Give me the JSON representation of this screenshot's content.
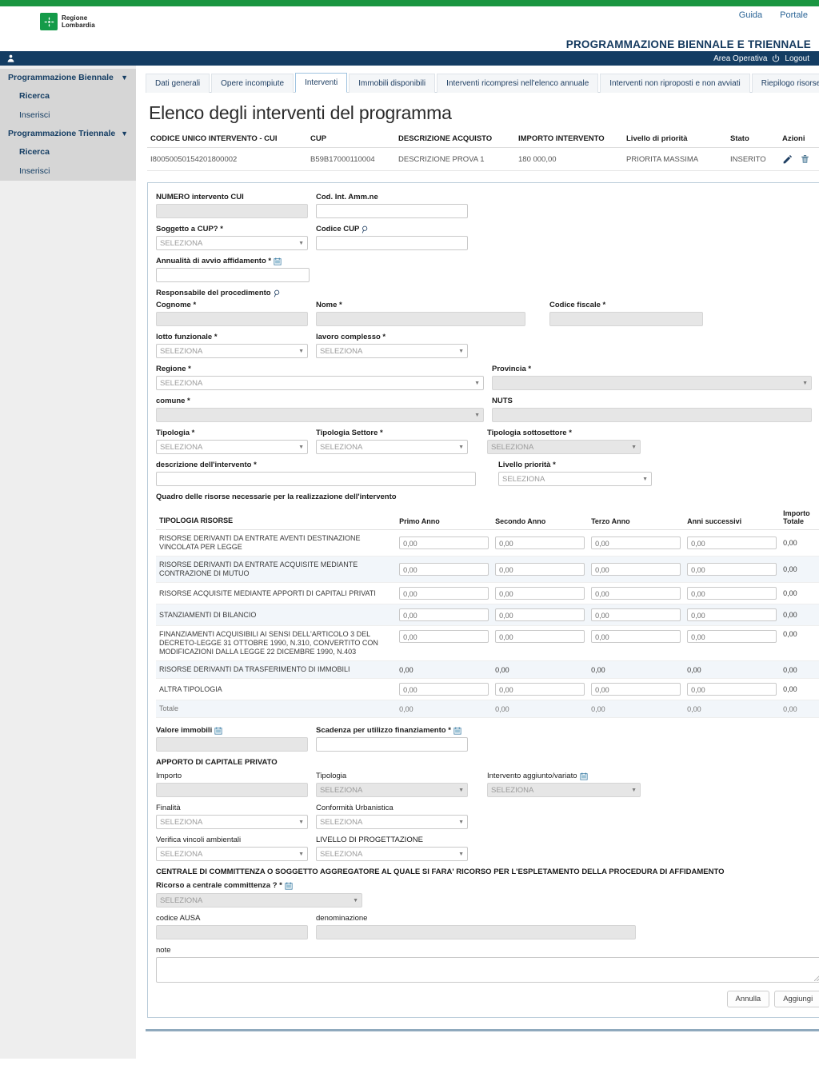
{
  "top": {
    "links": [
      {
        "label": "Guida",
        "name": "guida-link"
      },
      {
        "label": "Portale",
        "name": "portale-link"
      }
    ],
    "logo_line1": "Regione",
    "logo_line2": "Lombardia",
    "app_title": "PROGRAMMAZIONE BIENNALE E TRIENNALE",
    "user_area": "Area Operativa",
    "logout": "Logout"
  },
  "sidebar": {
    "groups": [
      {
        "label": "Programmazione Biennale",
        "caret": "▼",
        "items": [
          {
            "label": "Ricerca"
          },
          {
            "label": "Inserisci"
          }
        ]
      },
      {
        "label": "Programmazione Triennale",
        "caret": "▼",
        "items": [
          {
            "label": "Ricerca"
          },
          {
            "label": "Inserisci"
          }
        ]
      }
    ]
  },
  "tabs": [
    {
      "label": "Dati generali",
      "active": false
    },
    {
      "label": "Opere incompiute",
      "active": false
    },
    {
      "label": "Interventi",
      "active": true
    },
    {
      "label": "Immobili disponibili",
      "active": false
    },
    {
      "label": "Interventi ricompresi nell'elenco annuale",
      "active": false
    },
    {
      "label": "Interventi non riproposti e non avviati",
      "active": false
    },
    {
      "label": "Riepilogo risorse",
      "active": false
    }
  ],
  "page_title": "Elenco degli interventi del programma",
  "list_table": {
    "headers": [
      "CODICE UNICO INTERVENTO - CUI",
      "CUP",
      "DESCRIZIONE ACQUISTO",
      "IMPORTO INTERVENTO",
      "Livello di priorità",
      "Stato",
      "Azioni"
    ],
    "rows": [
      {
        "cui": "I80050050154201800002",
        "cup": "B59B17000110004",
        "descrizione": "DESCRIZIONE PROVA 1",
        "importo": "180 000,00",
        "priorita": "PRIORITA MASSIMA",
        "stato": "INSERITO"
      }
    ]
  },
  "form": {
    "numero_cui": {
      "label": "NUMERO intervento CUI",
      "value": ""
    },
    "cod_int_amm": {
      "label": "Cod. Int. Amm.ne",
      "value": ""
    },
    "soggetto_cup": {
      "label": "Soggetto a CUP? *",
      "value": "SELEZIONA"
    },
    "codice_cup": {
      "label": "Codice CUP",
      "value": ""
    },
    "annualita": {
      "label": "Annualità di avvio affidamento *",
      "value": ""
    },
    "responsabile_heading": "Responsabile del procedimento",
    "cognome": {
      "label": "Cognome *",
      "value": ""
    },
    "nome": {
      "label": "Nome *",
      "value": ""
    },
    "codice_fiscale": {
      "label": "Codice fiscale *",
      "value": ""
    },
    "lotto": {
      "label": "lotto funzionale *",
      "value": "SELEZIONA"
    },
    "lavoro": {
      "label": "lavoro complesso *",
      "value": "SELEZIONA"
    },
    "regione": {
      "label": "Regione *",
      "value": "SELEZIONA"
    },
    "provincia": {
      "label": "Provincia *",
      "value": ""
    },
    "comune": {
      "label": "comune *",
      "value": ""
    },
    "nuts": {
      "label": "NUTS",
      "value": ""
    },
    "tipologia": {
      "label": "Tipologia *",
      "value": "SELEZIONA"
    },
    "tipologia_settore": {
      "label": "Tipologia Settore *",
      "value": "SELEZIONA"
    },
    "tipologia_sottosettore": {
      "label": "Tipologia sottosettore *",
      "value": "SELEZIONA"
    },
    "descrizione_intervento": {
      "label": "descrizione dell'intervento *",
      "value": ""
    },
    "livello_priorita": {
      "label": "Livello priorità *",
      "value": "SELEZIONA"
    },
    "quadro_heading": "Quadro delle risorse necessarie per la realizzazione dell'intervento",
    "valore_immobili": {
      "label": "Valore immobili",
      "value": ""
    },
    "scadenza": {
      "label": "Scadenza per utilizzo finanziamento *",
      "value": ""
    },
    "apporto_heading": "APPORTO DI CAPITALE PRIVATO",
    "importo": {
      "label": "Importo",
      "value": ""
    },
    "tipologia_apporto": {
      "label": "Tipologia",
      "value": "SELEZIONA"
    },
    "intervento_aggiunto": {
      "label": "Intervento aggiunto/variato",
      "value": "SELEZIONA"
    },
    "finalita": {
      "label": "Finalità",
      "value": "SELEZIONA"
    },
    "conformita": {
      "label": "Conformità Urbanistica",
      "value": "SELEZIONA"
    },
    "verifica_vincoli": {
      "label": "Verifica vincoli ambientali",
      "value": "SELEZIONA"
    },
    "livello_progettazione": {
      "label": "LIVELLO DI PROGETTAZIONE",
      "value": "SELEZIONA"
    },
    "centrale_heading": "CENTRALE DI COMMITTENZA O SOGGETTO AGGREGATORE AL QUALE SI FARA' RICORSO PER L'ESPLETAMENTO DELLA PROCEDURA DI AFFIDAMENTO",
    "ricorso": {
      "label": "Ricorso a centrale committenza ? *",
      "value": "SELEZIONA"
    },
    "codice_ausa": {
      "label": "codice AUSA",
      "value": ""
    },
    "denominazione": {
      "label": "denominazione",
      "value": ""
    },
    "note": {
      "label": "note",
      "value": ""
    },
    "cancel_label": "Annulla",
    "submit_label": "Aggiungi"
  },
  "resources_table": {
    "headers": [
      "TIPOLOGIA RISORSE",
      "Primo Anno",
      "Secondo Anno",
      "Terzo Anno",
      "Anni successivi",
      "Importo Totale"
    ],
    "total_header_line1": "Importo",
    "total_header_line2": "Totale",
    "rows": [
      {
        "name": "RISORSE DERIVANTI DA ENTRATE AVENTI DESTINAZIONE VINCOLATA PER LEGGE",
        "editable": true,
        "values": [
          "0,00",
          "0,00",
          "0,00",
          "0,00"
        ],
        "total": "0,00"
      },
      {
        "name": "RISORSE DERIVANTI DA ENTRATE ACQUISITE MEDIANTE CONTRAZIONE DI MUTUO",
        "editable": true,
        "values": [
          "0,00",
          "0,00",
          "0,00",
          "0,00"
        ],
        "total": "0,00"
      },
      {
        "name": "RISORSE ACQUISITE MEDIANTE APPORTI DI CAPITALI PRIVATI",
        "editable": true,
        "values": [
          "0,00",
          "0,00",
          "0,00",
          "0,00"
        ],
        "total": "0,00"
      },
      {
        "name": "STANZIAMENTI DI BILANCIO",
        "editable": true,
        "values": [
          "0,00",
          "0,00",
          "0,00",
          "0,00"
        ],
        "total": "0,00"
      },
      {
        "name": "FINANZIAMENTI ACQUISIBILI AI SENSI DELL'ARTICOLO 3 DEL DECRETO-LEGGE 31 OTTOBRE 1990, N.310, CONVERTITO CON MODIFICAZIONI DALLA LEGGE 22 DICEMBRE 1990, N.403",
        "editable": true,
        "values": [
          "0,00",
          "0,00",
          "0,00",
          "0,00"
        ],
        "total": "0,00"
      },
      {
        "name": "RISORSE DERIVANTI DA TRASFERIMENTO DI IMMOBILI",
        "editable": false,
        "values": [
          "0,00",
          "0,00",
          "0,00",
          "0,00"
        ],
        "total": "0,00"
      },
      {
        "name": "ALTRA TIPOLOGIA",
        "editable": true,
        "values": [
          "0,00",
          "0,00",
          "0,00",
          "0,00"
        ],
        "total": "0,00"
      },
      {
        "name": "Totale",
        "editable": false,
        "is_total": true,
        "values": [
          "0,00",
          "0,00",
          "0,00",
          "0,00"
        ],
        "total": "0,00"
      }
    ]
  },
  "colors": {
    "green": "#1a9641",
    "navy": "#143d63",
    "panel_border": "#b8cbd9",
    "sidebar_bg": "#eeeeee",
    "sidebar_group": "#d6d6d6",
    "alt_row": "#f2f6fa"
  }
}
